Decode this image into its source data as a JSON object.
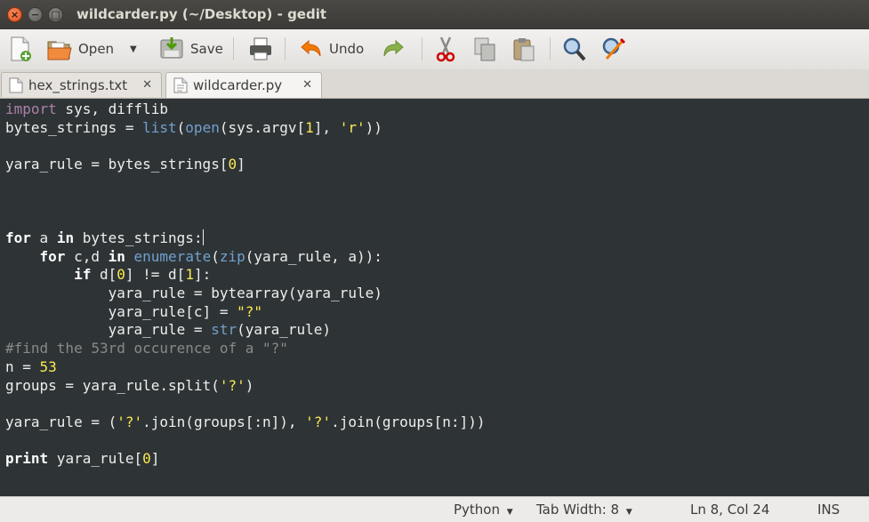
{
  "window": {
    "title": "wildcarder.py (~/Desktop) - gedit"
  },
  "toolbar": {
    "open_label": "Open",
    "save_label": "Save",
    "undo_label": "Undo"
  },
  "tabs": [
    {
      "label": "hex_strings.txt",
      "active": false
    },
    {
      "label": "wildcarder.py",
      "active": true
    }
  ],
  "editor": {
    "language": "python",
    "lines": [
      "import sys, difflib",
      "bytes_strings = list(open(sys.argv[1], 'r'))",
      "",
      "yara_rule = bytes_strings[0]",
      "",
      "",
      "",
      "for a in bytes_strings:",
      "    for c,d in enumerate(zip(yara_rule, a)):",
      "        if d[0] != d[1]:",
      "            yara_rule = bytearray(yara_rule)",
      "            yara_rule[c] = \"?\"",
      "            yara_rule = str(yara_rule)",
      "#find the 53rd occurence of a \"?\"",
      "n = 53",
      "groups = yara_rule.split('?')",
      "",
      "yara_rule = ('?'.join(groups[:n]), '?'.join(groups[n:]))",
      "",
      "print yara_rule[0]"
    ]
  },
  "statusbar": {
    "language": "Python",
    "tab_width": "Tab Width: 8",
    "position": "Ln 8, Col 24",
    "mode": "INS"
  }
}
